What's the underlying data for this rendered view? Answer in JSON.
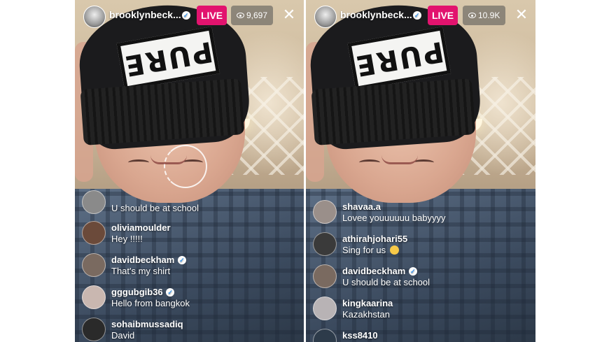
{
  "left_screen": {
    "username": "brooklynbeck...",
    "live_label": "LIVE",
    "viewer_count": "9,697",
    "comments": [
      {
        "user": "",
        "text": "U should be at school",
        "avatar_color": "#8a8a8a"
      },
      {
        "user": "oliviamoulder",
        "text": "Hey !!!!!",
        "avatar_color": "#6b4a3a"
      },
      {
        "user": "davidbeckham",
        "verified": true,
        "text": "That's my shirt",
        "avatar_color": "#7a6a60"
      },
      {
        "user": "gggubgib36",
        "verified": true,
        "text": "Hello from bangkok",
        "avatar_color": "#c9b7b0"
      },
      {
        "user": "sohaibmussadiq",
        "text": "David",
        "avatar_color": "#2a2a2a"
      }
    ]
  },
  "right_screen": {
    "username": "brooklynbeck...",
    "live_label": "LIVE",
    "viewer_count": "10.9K",
    "comments": [
      {
        "user": "shavaa.a",
        "text": "Lovee youuuuuu babyyyy",
        "avatar_color": "#9a8f8a"
      },
      {
        "user": "athirahjohari55",
        "text": "Sing for us",
        "emoji": "laughing-crying",
        "avatar_color": "#3a3a3a"
      },
      {
        "user": "davidbeckham",
        "verified": true,
        "text": "U should be at school",
        "avatar_color": "#7a6a60"
      },
      {
        "user": "kingkaarina",
        "text": "Kazakhstan",
        "avatar_color": "#b8b3b5"
      },
      {
        "user": "kss8410",
        "text": "",
        "avatar_color": "#2d3b4a"
      }
    ]
  },
  "scene": {
    "beanie_text": "PURE",
    "live_color": "#e2136e",
    "verified_color": "#3897f0"
  }
}
